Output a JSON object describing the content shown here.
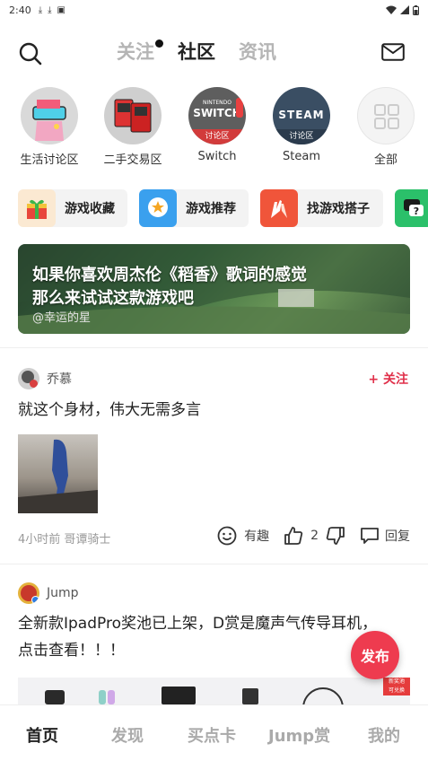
{
  "status_bar": {
    "time": "2:40",
    "icons": [
      "download-icon",
      "download-icon",
      "image-icon"
    ],
    "right_icons": [
      "wifi-icon",
      "signal-icon",
      "battery-icon"
    ]
  },
  "header": {
    "tabs": [
      {
        "label": "关注",
        "active": false,
        "has_dot": true
      },
      {
        "label": "社区",
        "active": true
      },
      {
        "label": "资讯",
        "active": false
      }
    ]
  },
  "forums": [
    {
      "label": "生活讨论区"
    },
    {
      "label": "二手交易区"
    },
    {
      "label": "Switch",
      "badge": "讨论区",
      "logo_top": "NINTENDO",
      "logo_main": "SWITCH"
    },
    {
      "label": "Steam",
      "badge": "讨论区",
      "logo_main": "STEAM"
    },
    {
      "label": "全部"
    }
  ],
  "shortcuts": [
    {
      "label": "游戏收藏",
      "icon": "gift-icon"
    },
    {
      "label": "游戏推荐",
      "icon": "star-chat-icon"
    },
    {
      "label": "找游戏搭子",
      "icon": "high-five-icon"
    },
    {
      "label": "",
      "icon": "question-chat-icon"
    }
  ],
  "banner": {
    "line1": "如果你喜欢周杰伦《稻香》歌词的感觉",
    "line2": "那么来试试这款游戏吧",
    "author": "@幸运的星"
  },
  "post1": {
    "author": "乔慕",
    "follow": "+ 关注",
    "text": "就这个身材，伟大无需多言",
    "meta": "4小时前 哥谭骑士",
    "fun_label": "有趣",
    "like_count": "2",
    "reply_label": "回复"
  },
  "post2": {
    "author": "Jump",
    "text_line1": "全新款IpadPro奖池已上架，D赏是魔声气传导耳机，",
    "text_line2": "点击查看！！！",
    "tag_line1": "新奖池",
    "tag_line2": "可兑换"
  },
  "fab": {
    "label": "发布"
  },
  "bottom_nav": [
    {
      "label": "首页",
      "active": true
    },
    {
      "label": "发现",
      "active": false
    },
    {
      "label": "买点卡",
      "active": false
    },
    {
      "label": "Jump赏",
      "active": false
    },
    {
      "label": "我的",
      "active": false
    }
  ],
  "colors": {
    "accent": "#ee3b4f",
    "follow": "#e0304a",
    "active_text": "#222222",
    "inactive_text": "#b5b5b5"
  }
}
